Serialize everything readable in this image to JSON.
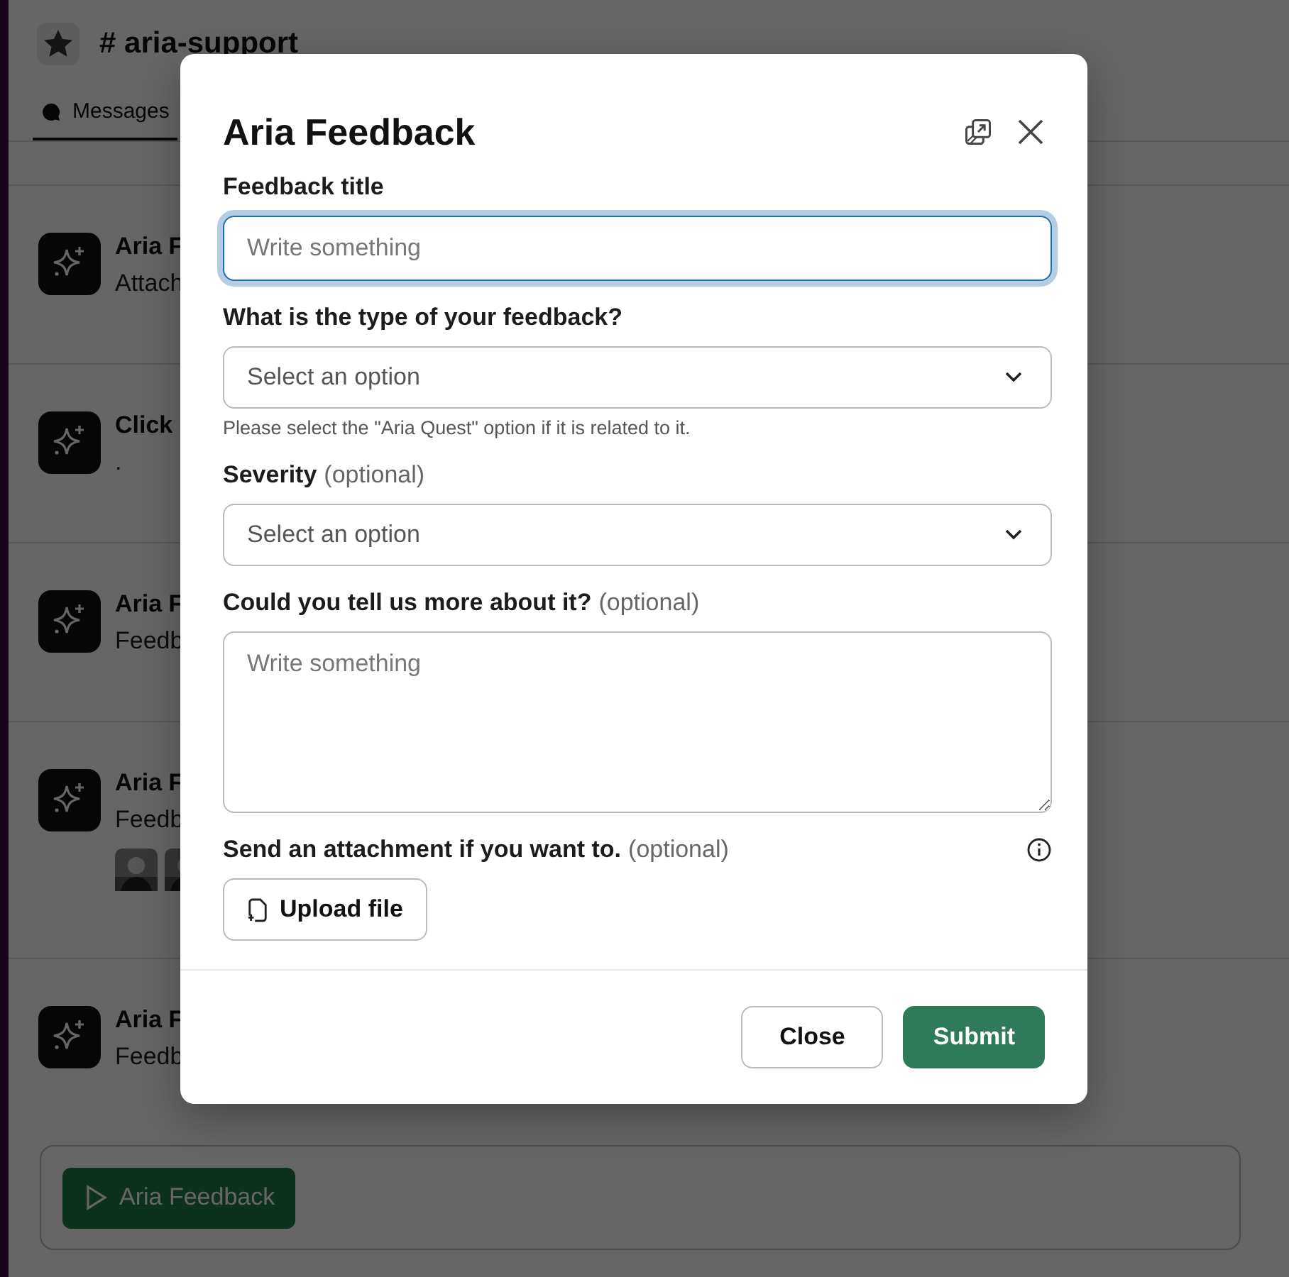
{
  "channel": {
    "name": "# aria-support",
    "tabs": [
      {
        "label": "Messages",
        "selected": true
      }
    ]
  },
  "messages": [
    {
      "sender": "Aria F",
      "text": "Attach"
    },
    {
      "sender": "Click",
      "text": "."
    },
    {
      "sender": "Aria F",
      "text": "Feedb"
    },
    {
      "sender": "Aria F",
      "text": "Feedb"
    },
    {
      "sender": "Aria F",
      "text": "Feedb"
    }
  ],
  "composer": {
    "workflow_button": "Aria Feedback"
  },
  "modal": {
    "title": "Aria Feedback",
    "fields": [
      {
        "kind": "text",
        "label": "Feedback title",
        "placeholder": "Write something",
        "focused": true
      },
      {
        "kind": "select",
        "label": "What is the type of your feedback?",
        "placeholder": "Select an option",
        "hint": "Please select the \"Aria Quest\" option if it is related to it."
      },
      {
        "kind": "select",
        "label": "Severity",
        "optional": "(optional)",
        "placeholder": "Select an option"
      },
      {
        "kind": "textarea",
        "label": "Could you tell us more about it?",
        "optional": "(optional)",
        "placeholder": "Write something"
      },
      {
        "kind": "file",
        "label": "Send an attachment if you want to.",
        "optional": "(optional)",
        "button": "Upload file",
        "info": true
      }
    ],
    "buttons": [
      {
        "label": "Close",
        "kind": "secondary"
      },
      {
        "label": "Submit",
        "kind": "primary"
      }
    ]
  }
}
